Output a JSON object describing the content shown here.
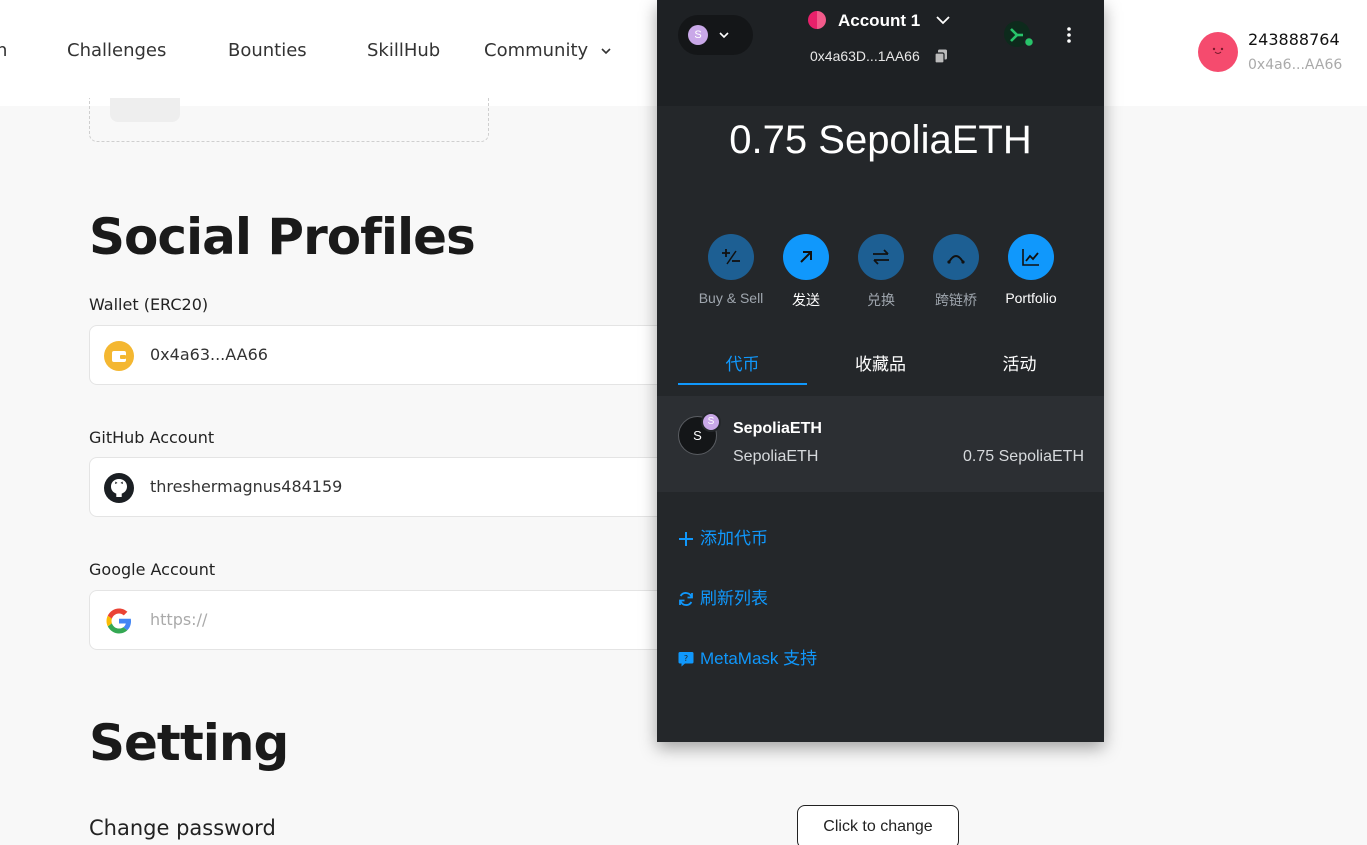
{
  "nav": {
    "cut_item": "n",
    "items": [
      "Challenges",
      "Bounties",
      "SkillHub",
      "Community"
    ],
    "user_name": "243888764",
    "user_address": "0x4a6...AA66"
  },
  "sections": {
    "social_title": "Social Profiles",
    "setting_title": "Setting"
  },
  "fields": {
    "wallet": {
      "label": "Wallet (ERC20)",
      "value": "0x4a63...AA66"
    },
    "github": {
      "label": "GitHub Account",
      "value": "threshermagnus484159"
    },
    "google": {
      "label": "Google Account",
      "placeholder": "https://"
    }
  },
  "setting": {
    "change_password_label": "Change password",
    "change_button": "Click to change"
  },
  "metamask": {
    "network_badge": "S",
    "account_name": "Account 1",
    "account_address": "0x4a63D...1AA66",
    "balance": "0.75 SepoliaETH",
    "actions": [
      "Buy & Sell",
      "发送",
      "兑换",
      "跨链桥",
      "Portfolio"
    ],
    "tabs": [
      "代币",
      "收藏品",
      "活动"
    ],
    "active_tab": "代币",
    "token": {
      "avatar": "S",
      "badge": "S",
      "name": "SepoliaETH",
      "subtitle": "SepoliaETH",
      "amount": "0.75 SepoliaETH"
    },
    "links": {
      "add_token": "添加代币",
      "refresh": "刷新列表",
      "support": "MetaMask 支持"
    },
    "colors": {
      "accent": "#1098fc",
      "action_bg": "#1d5f93",
      "panel_bg": "#24272a"
    }
  }
}
